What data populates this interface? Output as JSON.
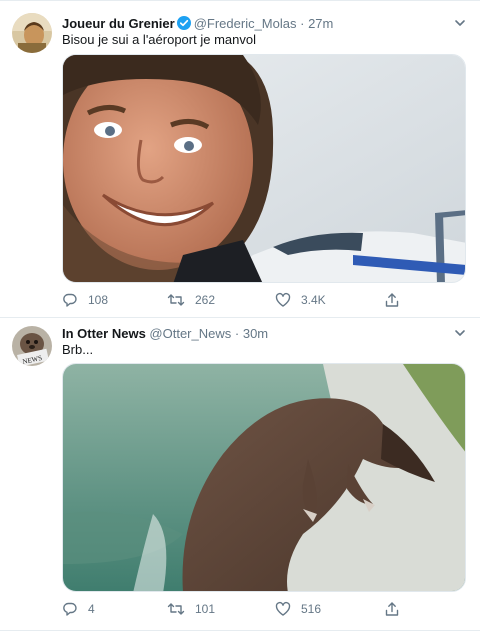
{
  "tweets": [
    {
      "display_name": "Joueur du Grenier",
      "handle": "@Frederic_Molas",
      "separator": "·",
      "time": "27m",
      "text": "Bisou je sui a l'aéroport je manvol",
      "replies": "108",
      "retweets": "262",
      "likes": "3.4K"
    },
    {
      "display_name": "In Otter News",
      "handle": "@Otter_News",
      "separator": "·",
      "time": "30m",
      "text": "Brb...",
      "replies": "4",
      "retweets": "101",
      "likes": "516"
    }
  ],
  "colors": {
    "accent": "#1da1f2",
    "muted": "#657786",
    "border": "#e6ecf0"
  },
  "icons": [
    "verified-badge-icon",
    "chevron-down-icon",
    "reply-icon",
    "retweet-icon",
    "like-icon",
    "share-icon"
  ]
}
